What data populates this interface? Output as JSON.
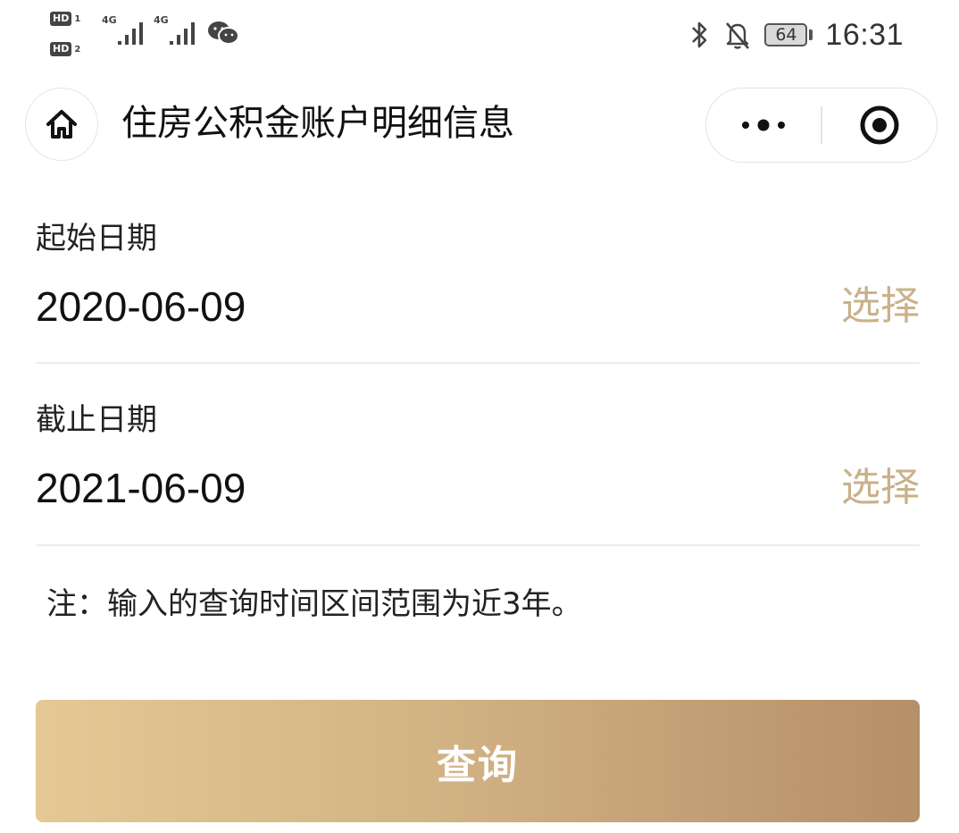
{
  "status_bar": {
    "sim1_tag": "HD",
    "sim1_num": "1",
    "sim2_tag": "HD",
    "sim2_num": "2",
    "network1": "4G",
    "network2": "4G",
    "battery": "64",
    "time": "16:31",
    "icons": [
      "wechat-icon",
      "bluetooth-icon",
      "bell-off-icon",
      "battery-icon"
    ]
  },
  "nav": {
    "title": "住房公积金账户明细信息",
    "icons": [
      "home-icon",
      "more-dots-icon",
      "close-target-icon"
    ]
  },
  "form": {
    "start": {
      "label": "起始日期",
      "value": "2020-06-09",
      "action": "选择"
    },
    "end": {
      "label": "截止日期",
      "value": "2021-06-09",
      "action": "选择"
    },
    "note": "注：输入的查询时间区间范围为近3年。"
  },
  "query_button": {
    "label": "查询"
  },
  "colors": {
    "accent": "#c9b18a",
    "button_gradient_start": "#e5c894",
    "button_gradient_end": "#b68f68"
  }
}
